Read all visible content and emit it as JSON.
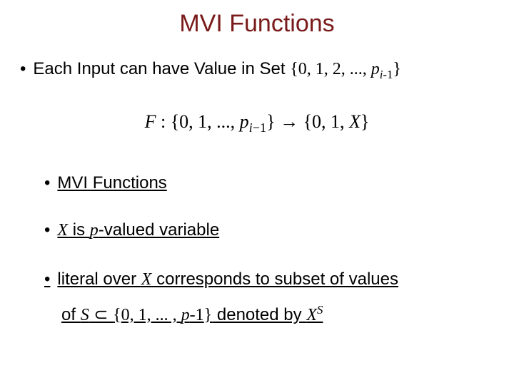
{
  "title": "MVI Functions",
  "bullet1_prefix": "Each Input can have Value in Set ",
  "set_open": "{",
  "set_vals": "0, 1, 2, ..., ",
  "set_p": "p",
  "set_sub_i": "i",
  "set_sub_minus1": "-1",
  "set_close": "}",
  "formula_F": "F",
  "formula_colon": " : ",
  "formula_dom_open": "{",
  "formula_dom_vals": "0, 1, ..., ",
  "formula_dom_p": "p",
  "formula_dom_sub_i": "i",
  "formula_dom_sub_m1": "−1",
  "formula_dom_close": "}",
  "formula_arrow": " → ",
  "formula_cod": "{0, 1, ",
  "formula_cod_X": "X",
  "formula_cod_close": "}",
  "sub1": "MVI Functions",
  "sub2_X": "X",
  "sub2_mid": " is ",
  "sub2_p": "p",
  "sub2_tail": "-valued variable",
  "sub3_a": "literal over ",
  "sub3_X": "X",
  "sub3_b": " corresponds to subset of values",
  "sub3_c": "of ",
  "sub3_S": "S",
  "sub3_subset": " ⊂ ",
  "sub3_set_open": "{",
  "sub3_set_vals": "0, 1, ... , ",
  "sub3_set_p": "p",
  "sub3_set_m1": "-1",
  "sub3_set_close": "}",
  "sub3_d": " denoted by ",
  "sub3_X2": "X",
  "sub3_sup": "S"
}
